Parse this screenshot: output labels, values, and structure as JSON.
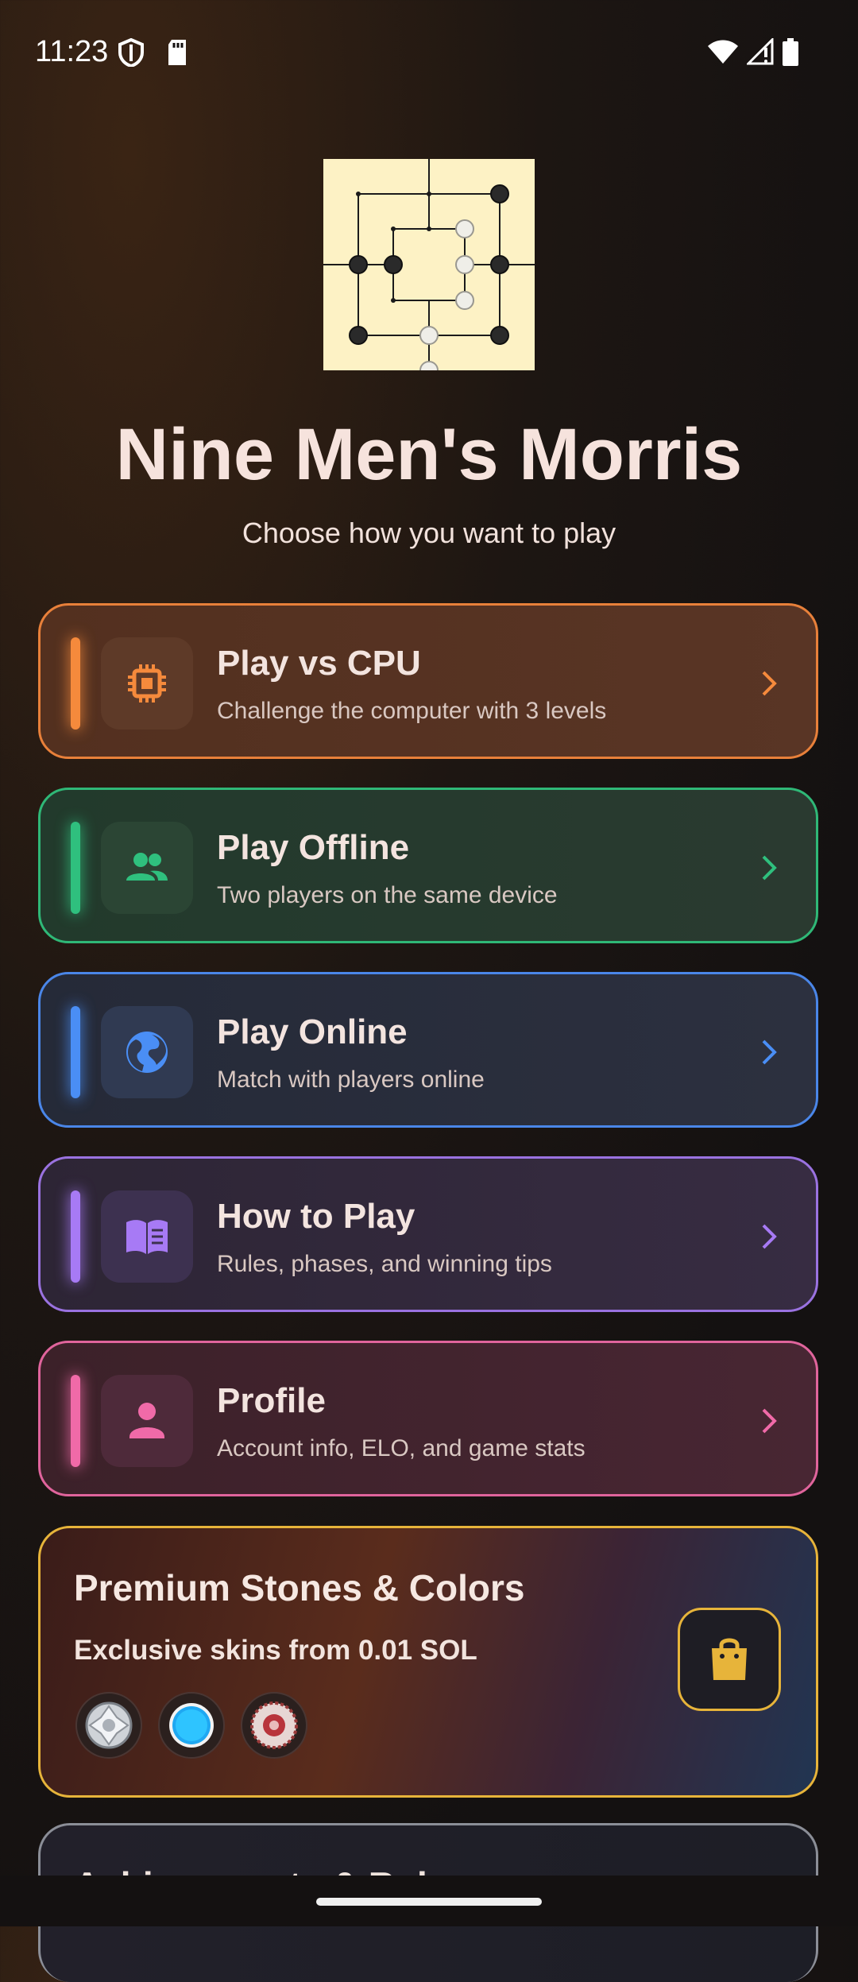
{
  "status_bar": {
    "time": "11:23"
  },
  "header": {
    "title": "Nine Men's Morris",
    "subtitle": "Choose how you want to play"
  },
  "menu": [
    {
      "title": "Play vs CPU",
      "subtitle": "Challenge the computer with 3 levels",
      "icon": "cpu-chip-icon",
      "accent": "#f58a3c"
    },
    {
      "title": "Play Offline",
      "subtitle": "Two players on the same device",
      "icon": "people-icon",
      "accent": "#2fc07e"
    },
    {
      "title": "Play Online",
      "subtitle": "Match with players online",
      "icon": "globe-icon",
      "accent": "#4a8ef5"
    },
    {
      "title": "How to Play",
      "subtitle": "Rules, phases, and winning tips",
      "icon": "book-icon",
      "accent": "#a77af5"
    },
    {
      "title": "Profile",
      "subtitle": "Account info, ELO, and game stats",
      "icon": "person-icon",
      "accent": "#f06aa8"
    }
  ],
  "premium": {
    "title": "Premium Stones & Colors",
    "subtitle": "Exclusive skins from 0.01 SOL",
    "accent": "#e7b43a",
    "swatches": [
      "diamond-stone-icon",
      "blue-stone-icon",
      "ruby-stone-icon"
    ]
  },
  "next_card": {
    "title": "Achievements & Rules"
  }
}
